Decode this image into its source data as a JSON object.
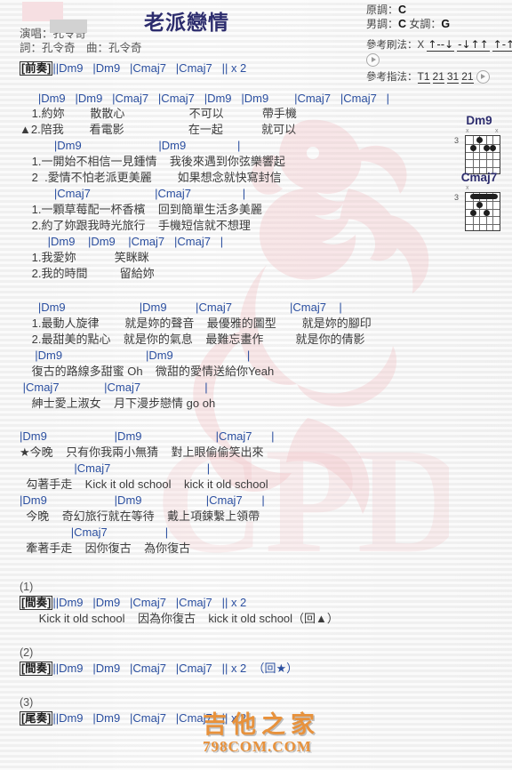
{
  "page": {
    "title": "老派戀情",
    "singer_label": "演唱：孔令奇",
    "writer_label": "詞：孔令奇　曲：孔令奇"
  },
  "keyinfo": {
    "original_key_label": "原調：",
    "original_key": "C",
    "male_key_label": "男調：",
    "male_key": "C",
    "female_key_label": "女調：",
    "female_key": "G",
    "strum_label": "參考刷法：",
    "strum_x": "X",
    "strum_patterns": [
      "↑--↓",
      "-↓↑↑",
      "↑-↑↓"
    ],
    "finger_label": "參考指法：",
    "finger_patterns": [
      "T1",
      "21",
      "31",
      "21"
    ]
  },
  "chords": [
    {
      "name": "Dm9",
      "start_fret": "3",
      "muted_strings": [
        "x",
        "x"
      ],
      "dots": [
        {
          "string": 3,
          "fret": 1
        },
        {
          "string": 2,
          "fret": 2
        },
        {
          "string": 4,
          "fret": 2
        },
        {
          "string": 5,
          "fret": 2
        }
      ]
    },
    {
      "name": "Cmaj7",
      "start_fret": "3",
      "muted_strings": [
        "x"
      ],
      "barre": {
        "fret": 1,
        "from": 2,
        "to": 5
      },
      "dots": [
        {
          "string": 3,
          "fret": 2
        },
        {
          "string": 2,
          "fret": 3
        },
        {
          "string": 4,
          "fret": 3
        }
      ]
    }
  ],
  "song": {
    "intro": {
      "marker": "[前奏]",
      "chords": "||Dm9   |Dm9   |Cmaj7   |Cmaj7   || x 2"
    },
    "blocks": [
      {
        "id": "verse-1",
        "lines": [
          {
            "type": "chord",
            "text": "   |Dm9   |Dm9   |Cmaj7   |Cmaj7   |Dm9   |Dm9        |Cmaj7   |Cmaj7   |"
          },
          {
            "type": "lyric",
            "text": " 1.約妳        散散心                    不可以            帶手機"
          },
          {
            "type": "lyric",
            "text": "▲2.陪我        看電影                    在一起            就可以"
          }
        ]
      },
      {
        "id": "verse-2",
        "lines": [
          {
            "type": "chord",
            "text": "        |Dm9                        |Dm9                |"
          },
          {
            "type": "lyric",
            "text": " 1.一開始不相信一見鍾情    我後來遇到你弦樂響起"
          },
          {
            "type": "lyric",
            "text": " 2  .愛情不怕老派更美麗        如果想念就快寫封信"
          }
        ]
      },
      {
        "id": "verse-3",
        "lines": [
          {
            "type": "chord",
            "text": "        |Cmaj7                    |Cmaj7                |"
          },
          {
            "type": "lyric",
            "text": " 1.一顆草莓配一杯香檳    回到簡單生活多美麗"
          },
          {
            "type": "lyric",
            "text": " 2.約了妳跟我時光旅行    手機短信就不想理"
          }
        ]
      },
      {
        "id": "verse-4",
        "lines": [
          {
            "type": "chord",
            "text": "      |Dm9    |Dm9    |Cmaj7   |Cmaj7   |"
          },
          {
            "type": "lyric",
            "text": " 1.我愛妳            笑眯眯"
          },
          {
            "type": "lyric",
            "text": " 2.我的時間          留給妳"
          }
        ]
      },
      {
        "id": "chorus-1",
        "lines": [
          {
            "type": "chord",
            "text": "   |Dm9                       |Dm9         |Cmaj7                  |Cmaj7    |"
          },
          {
            "type": "lyric",
            "text": " 1.最動人旋律        就是妳的聲音    最優雅的圖型        就是妳的腳印"
          },
          {
            "type": "lyric",
            "text": " 2.最甜美的點心    就是你的氣息    最難忘畫作          就是你的倩影"
          }
        ]
      },
      {
        "id": "chorus-2",
        "lines": [
          {
            "type": "chord",
            "text": "  |Dm9                          |Dm9                       |"
          },
          {
            "type": "lyric",
            "text": " 復古的路線多甜蜜 Oh    微甜的愛情送給你Yeah"
          }
        ]
      },
      {
        "id": "chorus-3",
        "lines": [
          {
            "type": "chord",
            "text": " |Cmaj7              |Cmaj7                    |"
          },
          {
            "type": "lyric",
            "text": " 紳士愛上淑女    月下漫步戀情 go oh"
          }
        ]
      },
      {
        "id": "bridge-1",
        "lines": [
          {
            "type": "chord",
            "text": "|Dm9                     |Dm9                       |Cmaj7      |"
          },
          {
            "type": "lyric",
            "text": "★今晚    只有你我兩小無猜    對上眼偷偷笑出來"
          }
        ]
      },
      {
        "id": "bridge-2",
        "lines": [
          {
            "type": "chord",
            "text": "                 |Cmaj7                              |"
          },
          {
            "type": "lyric",
            "text": "  勾著手走    Kick it old school    kick it old school"
          }
        ]
      },
      {
        "id": "bridge-3",
        "lines": [
          {
            "type": "chord",
            "text": "|Dm9                     |Dm9                    |Cmaj7      |"
          },
          {
            "type": "lyric",
            "text": "  今晚    奇幻旅行就在等待    戴上項鍊繫上領帶"
          }
        ]
      },
      {
        "id": "bridge-4",
        "lines": [
          {
            "type": "chord",
            "text": "                |Cmaj7                  |"
          },
          {
            "type": "lyric",
            "text": "  牽著手走    因你復古    為你復古"
          }
        ]
      }
    ],
    "outro_sections": [
      {
        "number": "(1)",
        "marker": "[間奏]",
        "chords": "||Dm9   |Dm9   |Cmaj7   |Cmaj7   || x 2",
        "extra": "      Kick it old school    因為你復古    kick it old school（回▲）"
      },
      {
        "number": "(2)",
        "marker": "[間奏]",
        "chords": "||Dm9   |Dm9   |Cmaj7   |Cmaj7   || x 2  （回★）",
        "extra": ""
      },
      {
        "number": "(3)",
        "marker": "[尾奏]",
        "chords": "||Dm9   |Dm9   |Cmaj7   |Cmaj7   || x 2",
        "extra": ""
      }
    ]
  },
  "watermark": {
    "site_cn": "吉他之家",
    "site_en": "798COM.COM"
  }
}
